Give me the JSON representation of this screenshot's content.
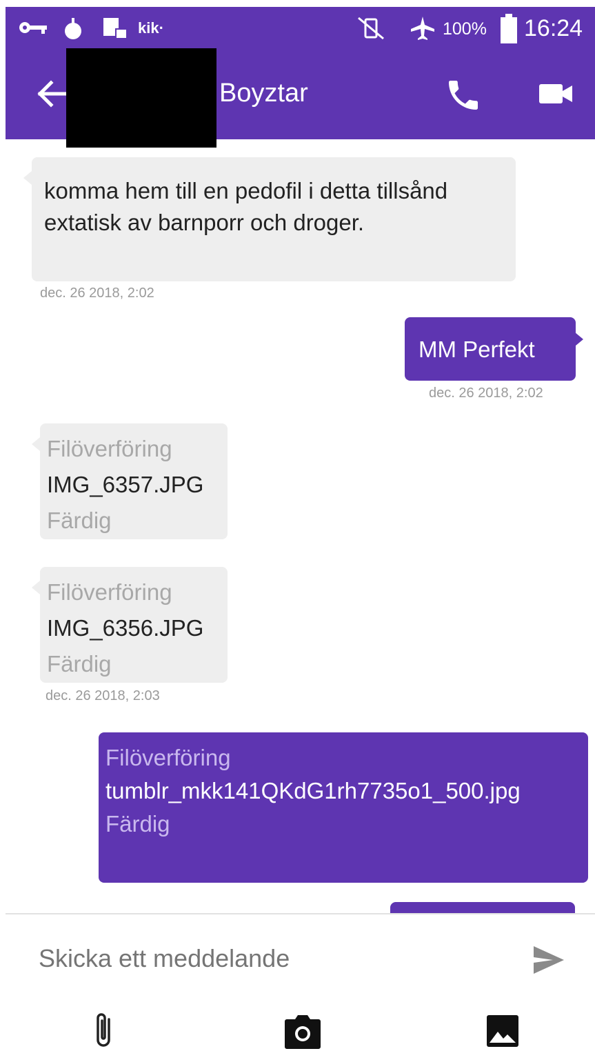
{
  "status_bar": {
    "app_badge": "kik·",
    "battery": "100%",
    "time": "16:24"
  },
  "header": {
    "contact_name": "Boyztar"
  },
  "messages": [
    {
      "text": "komma hem till en pedofil i detta tillsånd extatisk av barnporr och droger.",
      "timestamp": "dec. 26 2018, 2:02"
    },
    {
      "text": "MM Perfekt",
      "timestamp": "dec. 26 2018, 2:02"
    },
    {
      "title": "Filöverföring",
      "filename": "IMG_6357.JPG",
      "status": "Färdig"
    },
    {
      "title": "Filöverföring",
      "filename": "IMG_6356.JPG",
      "status": "Färdig",
      "timestamp": "dec. 26 2018, 2:03"
    },
    {
      "title": "Filöverföring",
      "filename": "tumblr_mkk141QKdG1rh7735o1_500.jpg",
      "status": "Färdig"
    }
  ],
  "composer": {
    "placeholder": "Skicka ett meddelande"
  },
  "colors": {
    "primary": "#5e35b1",
    "incoming_bubble": "#eeeeee"
  }
}
